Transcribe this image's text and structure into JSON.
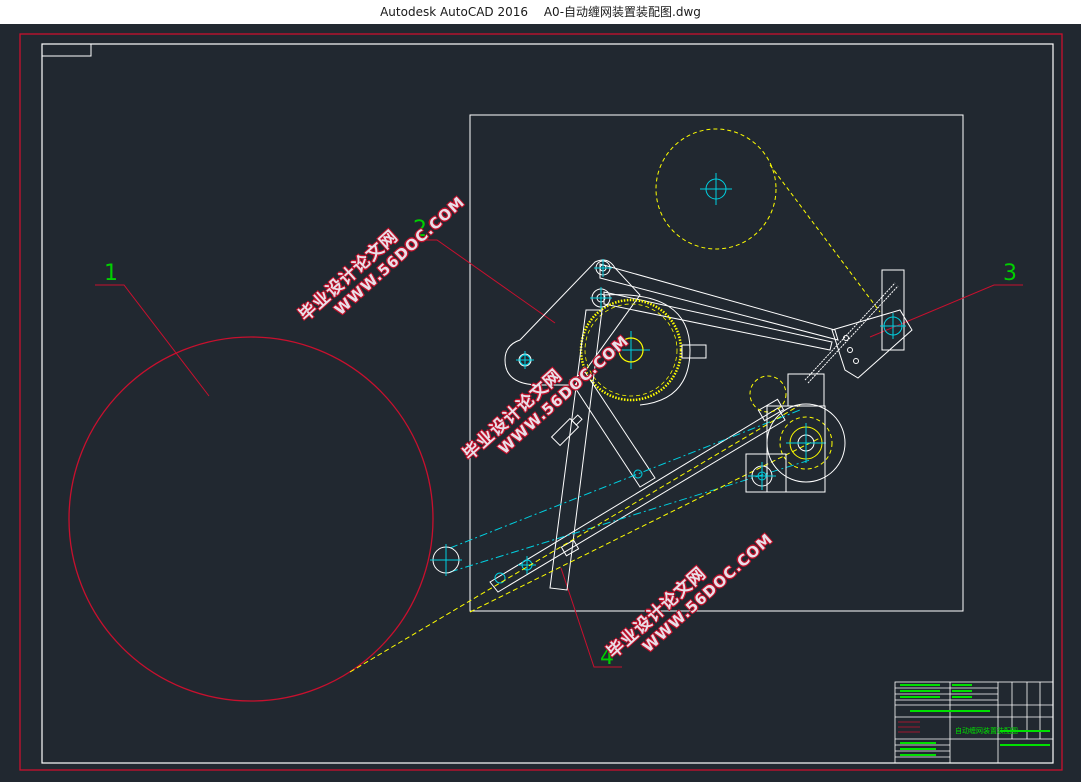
{
  "window": {
    "app_name": "Autodesk AutoCAD 2016",
    "file_name": "A0-自动缠网装置装配图.dwg"
  },
  "drawing": {
    "balloons": [
      "1",
      "2",
      "3",
      "4"
    ],
    "colors": {
      "background": "#212830",
      "outer_frame": "#c8102e",
      "geometry": "#ffffff",
      "centerline": "#00d0e0",
      "gear": "#ffff00",
      "label": "#00d000",
      "balloon_line": "#c8102e"
    }
  },
  "watermarks": [
    {
      "cn": "毕业设计论文网",
      "url": "WWW.56DOC.COM"
    },
    {
      "cn": "毕业设计论文网",
      "url": "WWW.56DOC.COM"
    },
    {
      "cn": "毕业设计论文网",
      "url": "WWW.56DOC.COM"
    }
  ],
  "title_block": {
    "drawing_title": "自动缠网装置装配图"
  }
}
